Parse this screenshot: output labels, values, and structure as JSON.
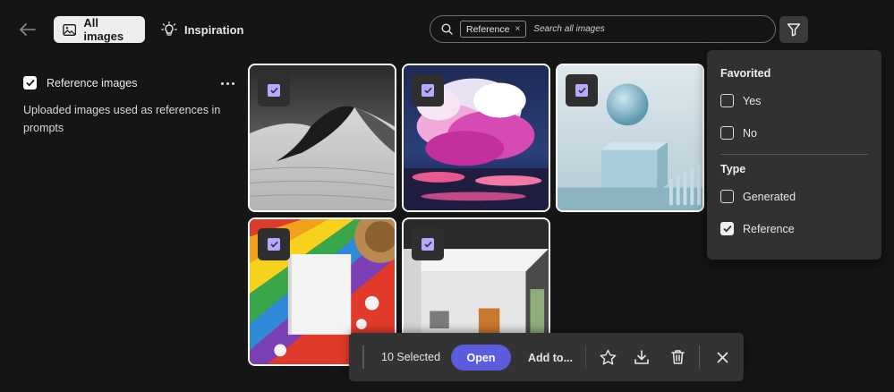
{
  "topbar": {
    "tabs": [
      {
        "label": "All images",
        "icon": "image-icon",
        "active": true
      },
      {
        "label": "Inspiration",
        "icon": "lightbulb-icon",
        "active": false
      }
    ],
    "search": {
      "chip_label": "Reference",
      "placeholder": "Search all images"
    }
  },
  "left_panel": {
    "checkbox_label": "Reference images",
    "checked": true,
    "description": "Uploaded images used as references in prompts"
  },
  "images": [
    {
      "subject": "desert-dunes",
      "selected": true
    },
    {
      "subject": "pink-clouds",
      "selected": true
    },
    {
      "subject": "sphere-cube",
      "selected": true
    },
    {
      "subject": "book-on-towel",
      "selected": true
    },
    {
      "subject": "room-interior",
      "selected": true
    }
  ],
  "filter_panel": {
    "sections": [
      {
        "heading": "Favorited",
        "options": [
          {
            "label": "Yes",
            "checked": false
          },
          {
            "label": "No",
            "checked": false
          }
        ]
      },
      {
        "heading": "Type",
        "options": [
          {
            "label": "Generated",
            "checked": false
          },
          {
            "label": "Reference",
            "checked": true
          }
        ]
      }
    ]
  },
  "action_bar": {
    "selected_count": "10 Selected",
    "open_label": "Open",
    "add_to_label": "Add to...",
    "icons": [
      "star-icon",
      "download-icon",
      "trash-icon",
      "close-icon"
    ]
  },
  "colors": {
    "background": "#151515",
    "accent": "#5c5ce0",
    "selection_check": "#b8a8ff",
    "panel": "#313131"
  }
}
